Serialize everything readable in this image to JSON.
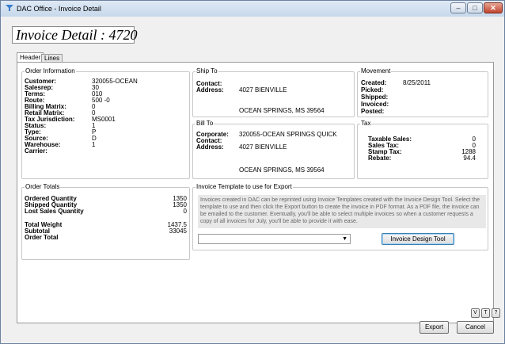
{
  "window": {
    "title": "DAC Office - Invoice Detail"
  },
  "heading": "Invoice Detail : 4720",
  "tabs": [
    {
      "label": "Header"
    },
    {
      "label": "Lines"
    }
  ],
  "order_info": {
    "title": "Order Information",
    "rows": [
      {
        "label": "Customer:",
        "value": "320055-OCEAN"
      },
      {
        "label": "Salesrep:",
        "value": "30"
      },
      {
        "label": "Terms:",
        "value": "010"
      },
      {
        "label": "Route:",
        "value": "500  -0"
      },
      {
        "label": "Billing Matrix:",
        "value": "0"
      },
      {
        "label": "Retail Matrix:",
        "value": "0"
      },
      {
        "label": "Tax Jurisdiction:",
        "value": "MS0001"
      },
      {
        "label": "Status:",
        "value": "1"
      },
      {
        "label": "Type:",
        "value": "P"
      },
      {
        "label": "Source:",
        "value": "D"
      },
      {
        "label": "Warehouse:",
        "value": "1"
      },
      {
        "label": "Carrier:",
        "value": ""
      }
    ]
  },
  "ship_to": {
    "title": "Ship To",
    "contact_label": "Contact:",
    "contact_value": "",
    "address_label": "Address:",
    "address_line1": "4027 BIENVILLE",
    "address_line2": "OCEAN SPRINGS, MS 39564"
  },
  "bill_to": {
    "title": "Bill To",
    "corporate_label": "Corporate:",
    "corporate_value": "320055-OCEAN SPRINGS QUICK",
    "contact_label": "Contact:",
    "contact_value": "",
    "address_label": "Address:",
    "address_line1": "4027 BIENVILLE",
    "address_line2": "OCEAN SPRINGS, MS 39564"
  },
  "movement": {
    "title": "Movement",
    "rows": [
      {
        "label": "Created:",
        "value": "8/25/2011"
      },
      {
        "label": "Picked:",
        "value": ""
      },
      {
        "label": "Shipped:",
        "value": ""
      },
      {
        "label": "Invoiced:",
        "value": ""
      },
      {
        "label": "Posted:",
        "value": ""
      }
    ]
  },
  "tax": {
    "title": "Tax",
    "rows": [
      {
        "label": "Taxable Sales:",
        "value": "0"
      },
      {
        "label": "Sales Tax:",
        "value": "0"
      },
      {
        "label": "Stamp Tax:",
        "value": "1288"
      },
      {
        "label": "Rebate:",
        "value": "94.4"
      }
    ]
  },
  "order_totals": {
    "title": "Order Totals",
    "ordered_label": "Ordered Quantity",
    "ordered_value": "1350",
    "shipped_label": "Shipped Quantity",
    "shipped_value": "1350",
    "lost_label": "Lost Sales Quantity",
    "lost_value": "0",
    "weight_label": "Total Weight",
    "weight_value": "1437.5",
    "subtotal_label": "Subtotal",
    "subtotal_value": "33045",
    "order_total_label": "Order Total",
    "order_total_value": ""
  },
  "export_template": {
    "title": "Invoice Template to use for Export",
    "description": "Invoices created in DAC can be reprinted using Invoice Templates created with the Invoice Design Tool. Select the template to use and then click the Export button to create the invoice in PDF format.  As a PDF file, the invoice can be emailed to the customer.  Eventually, you'll be able to select multiple invoices so when a customer requests a copy of all invoices for July, you'll be able to provide it with ease.",
    "selected_template": "",
    "design_tool_label": "Invoice Design Tool"
  },
  "small_buttons": [
    {
      "label": "V"
    },
    {
      "label": "T"
    },
    {
      "label": "?"
    }
  ],
  "footer": {
    "export_label": "Export",
    "cancel_label": "Cancel"
  },
  "colors": {
    "title_bar": "#c7d8ec",
    "close_button": "#c0452e",
    "focus_border": "#3c7fb1"
  }
}
